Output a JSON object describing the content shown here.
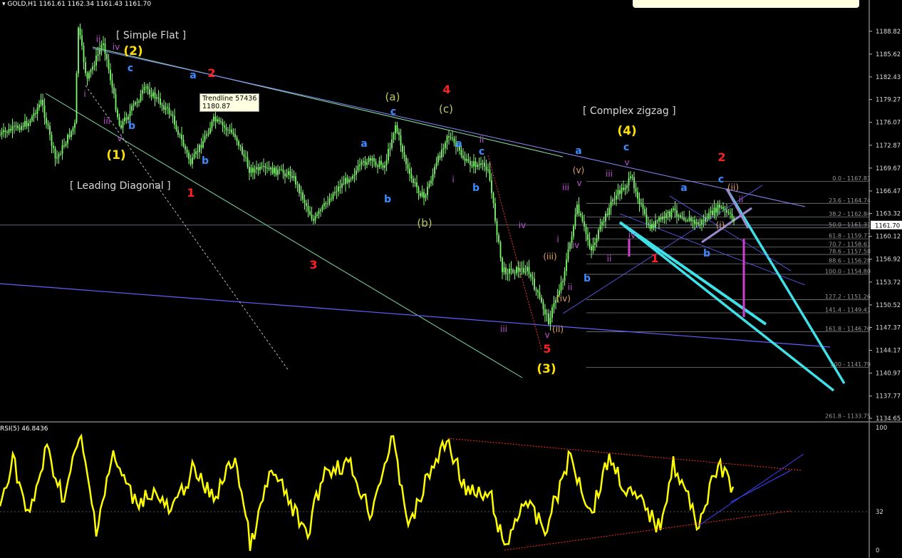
{
  "window": {
    "title": "GOLD,H1",
    "ohlc": "1161.61 1162.34 1161.43 1161.70",
    "rsi_title": "RSI(5) 46.8436"
  },
  "tooltip": {
    "name": "Trendline 57436",
    "value": "1180.87"
  },
  "colors": {
    "bg": "#000000",
    "candle": "#7cfc6b",
    "rsi": "#ffff00",
    "cyan": "#3fe0e8",
    "magenta": "#d040d0",
    "red": "#ff2020",
    "yellow": "#ffe000",
    "blue": "#3a8cff"
  },
  "chart_data": {
    "type": "candlestick",
    "symbol": "GOLD",
    "timeframe": "H1",
    "ylim": [
      1134.65,
      1190.5
    ],
    "price_ticks": [
      "1188.82",
      "1185.62",
      "1182.43",
      "1179.27",
      "1176.07",
      "1172.87",
      "1169.67",
      "1166.47",
      "1163.32",
      "1160.12",
      "1156.92",
      "1153.72",
      "1150.52",
      "1147.37",
      "1144.17",
      "1140.97",
      "1137.77",
      "1134.65"
    ],
    "current_price": "1161.70",
    "rsi": {
      "period": 5,
      "last": 46.8436,
      "ticks": [
        "100",
        "32",
        "0"
      ]
    },
    "fibonacci": [
      {
        "level": "0.0",
        "price": "1167.81"
      },
      {
        "level": "23.6",
        "price": "1164.74"
      },
      {
        "level": "38.2",
        "price": "1162.84"
      },
      {
        "level": "50.0",
        "price": "1161.31"
      },
      {
        "level": "61.8",
        "price": "1159.77"
      },
      {
        "level": "70.7",
        "price": "1158.61"
      },
      {
        "level": "78.6",
        "price": "1157.58"
      },
      {
        "level": "88.6",
        "price": "1156.28"
      },
      {
        "level": "100.0",
        "price": "1154.80"
      },
      {
        "level": "127.2",
        "price": "1151.26"
      },
      {
        "level": "141.4",
        "price": "1149.41"
      },
      {
        "level": "161.8",
        "price": "1146.76"
      },
      {
        "level": "200",
        "price": "1141.79"
      },
      {
        "level": "261.8",
        "price": "1133.75"
      }
    ],
    "annotations": {
      "simple_flat": "[ Simple Flat ]",
      "leading_diagonal": "[ Leading Diagonal ]",
      "complex_zigzag": "[ Complex zigzag ]"
    }
  },
  "labels": [
    {
      "t": "(1)",
      "x": 163,
      "y": 223,
      "c": "yellow",
      "s": 17
    },
    {
      "t": "(2)",
      "x": 187,
      "y": 77,
      "c": "yellow",
      "s": 17
    },
    {
      "t": "(3)",
      "x": 767,
      "y": 523,
      "c": "yellow",
      "s": 17
    },
    {
      "t": "(4)",
      "x": 880,
      "y": 189,
      "c": "yellow",
      "s": 17
    },
    {
      "t": "1",
      "x": 268,
      "y": 276,
      "c": "red",
      "s": 16
    },
    {
      "t": "2",
      "x": 297,
      "y": 108,
      "c": "red",
      "s": 16
    },
    {
      "t": "3",
      "x": 440,
      "y": 377,
      "c": "red",
      "s": 16
    },
    {
      "t": "4",
      "x": 627,
      "y": 131,
      "c": "red",
      "s": 16
    },
    {
      "t": "5",
      "x": 768,
      "y": 495,
      "c": "red",
      "s": 16
    },
    {
      "t": "1",
      "x": 919,
      "y": 368,
      "c": "red",
      "s": 16
    },
    {
      "t": "2",
      "x": 1013,
      "y": 226,
      "c": "red",
      "s": 16
    },
    {
      "t": "(a)",
      "x": 551,
      "y": 141,
      "c": "olive",
      "s": 15
    },
    {
      "t": "(b)",
      "x": 596,
      "y": 318,
      "c": "olive",
      "s": 15
    },
    {
      "t": "(c)",
      "x": 626,
      "y": 158,
      "c": "olive",
      "s": 15
    },
    {
      "t": "a",
      "x": 271,
      "y": 110,
      "c": "blue",
      "s": 14
    },
    {
      "t": "b",
      "x": 288,
      "y": 230,
      "c": "blue",
      "s": 14
    },
    {
      "t": "c",
      "x": 183,
      "y": 100,
      "c": "blue",
      "s": 14
    },
    {
      "t": "b",
      "x": 185,
      "y": 181,
      "c": "blue",
      "s": 14
    },
    {
      "t": "a",
      "x": 511,
      "y": 206,
      "c": "blue",
      "s": 14
    },
    {
      "t": "b",
      "x": 544,
      "y": 284,
      "c": "blue",
      "s": 14
    },
    {
      "t": "c",
      "x": 552,
      "y": 161,
      "c": "blue",
      "s": 14
    },
    {
      "t": "a",
      "x": 644,
      "y": 206,
      "c": "blue",
      "s": 14
    },
    {
      "t": "c",
      "x": 676,
      "y": 217,
      "c": "blue",
      "s": 14
    },
    {
      "t": "b",
      "x": 668,
      "y": 268,
      "c": "blue",
      "s": 14
    },
    {
      "t": "a",
      "x": 812,
      "y": 216,
      "c": "blue",
      "s": 14
    },
    {
      "t": "b",
      "x": 824,
      "y": 395,
      "c": "blue",
      "s": 14
    },
    {
      "t": "c",
      "x": 879,
      "y": 211,
      "c": "blue",
      "s": 14
    },
    {
      "t": "a",
      "x": 960,
      "y": 268,
      "c": "blue",
      "s": 14
    },
    {
      "t": "b",
      "x": 992,
      "y": 360,
      "c": "blue",
      "s": 14
    },
    {
      "t": "c",
      "x": 1012,
      "y": 256,
      "c": "blue",
      "s": 14
    },
    {
      "t": "i",
      "x": 119,
      "y": 136,
      "c": "magenta",
      "s": 12
    },
    {
      "t": "ii",
      "x": 138,
      "y": 59,
      "c": "magenta",
      "s": 12
    },
    {
      "t": "iii",
      "x": 150,
      "y": 174,
      "c": "magenta",
      "s": 12
    },
    {
      "t": "iv",
      "x": 163,
      "y": 70,
      "c": "magenta",
      "s": 12
    },
    {
      "t": "v",
      "x": 168,
      "y": 198,
      "c": "magenta",
      "s": 12
    },
    {
      "t": "i",
      "x": 636,
      "y": 256,
      "c": "magenta",
      "s": 12
    },
    {
      "t": "ii",
      "x": 676,
      "y": 200,
      "c": "magenta",
      "s": 12
    },
    {
      "t": "iii",
      "x": 707,
      "y": 466,
      "c": "magenta",
      "s": 12
    },
    {
      "t": "iv",
      "x": 733,
      "y": 320,
      "c": "magenta",
      "s": 12
    },
    {
      "t": "v",
      "x": 768,
      "y": 474,
      "c": "magenta",
      "s": 12
    },
    {
      "t": "i",
      "x": 783,
      "y": 340,
      "c": "magenta",
      "s": 12
    },
    {
      "t": "ii",
      "x": 800,
      "y": 407,
      "c": "magenta",
      "s": 12
    },
    {
      "t": "iii",
      "x": 794,
      "y": 267,
      "c": "magenta",
      "s": 12
    },
    {
      "t": "iv",
      "x": 808,
      "y": 348,
      "c": "magenta",
      "s": 12
    },
    {
      "t": "v",
      "x": 813,
      "y": 261,
      "c": "magenta",
      "s": 12
    },
    {
      "t": "iii",
      "x": 855,
      "y": 248,
      "c": "magenta",
      "s": 12
    },
    {
      "t": "ii",
      "x": 855,
      "y": 367,
      "c": "magenta",
      "s": 12
    },
    {
      "t": "v",
      "x": 880,
      "y": 232,
      "c": "magenta",
      "s": 12
    },
    {
      "t": "iv",
      "x": 887,
      "y": 334,
      "c": "magenta",
      "s": 12
    },
    {
      "t": "ii",
      "x": 1040,
      "y": 284,
      "c": "magenta",
      "s": 12
    },
    {
      "t": "(iii)",
      "x": 772,
      "y": 364,
      "c": "orange",
      "s": 12
    },
    {
      "t": "(iv)",
      "x": 791,
      "y": 423,
      "c": "orange",
      "s": 12
    },
    {
      "t": "(ii)",
      "x": 783,
      "y": 466,
      "c": "orange",
      "s": 12
    },
    {
      "t": "(v)",
      "x": 812,
      "y": 243,
      "c": "orange",
      "s": 12
    },
    {
      "t": "(ii)",
      "x": 1029,
      "y": 267,
      "c": "orange",
      "s": 12
    },
    {
      "t": "(i)",
      "x": 1011,
      "y": 320,
      "c": "orange",
      "s": 12
    }
  ]
}
